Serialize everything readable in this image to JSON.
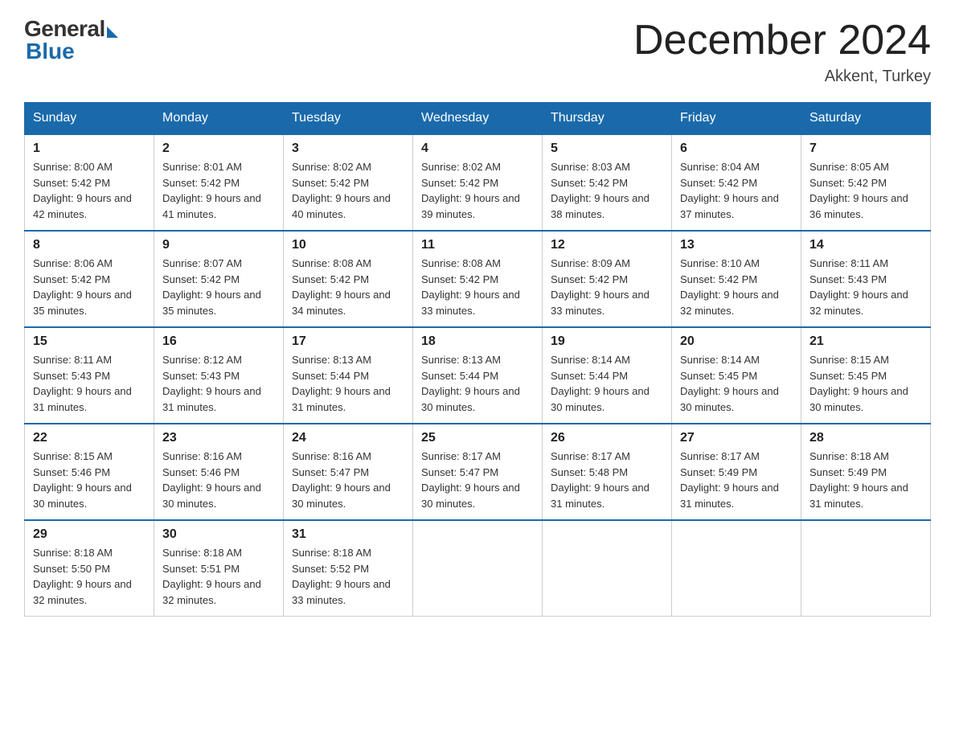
{
  "logo": {
    "general": "General",
    "blue": "Blue"
  },
  "title": "December 2024",
  "location": "Akkent, Turkey",
  "days_of_week": [
    "Sunday",
    "Monday",
    "Tuesday",
    "Wednesday",
    "Thursday",
    "Friday",
    "Saturday"
  ],
  "weeks": [
    [
      {
        "day": "1",
        "sunrise": "8:00 AM",
        "sunset": "5:42 PM",
        "daylight": "9 hours and 42 minutes."
      },
      {
        "day": "2",
        "sunrise": "8:01 AM",
        "sunset": "5:42 PM",
        "daylight": "9 hours and 41 minutes."
      },
      {
        "day": "3",
        "sunrise": "8:02 AM",
        "sunset": "5:42 PM",
        "daylight": "9 hours and 40 minutes."
      },
      {
        "day": "4",
        "sunrise": "8:02 AM",
        "sunset": "5:42 PM",
        "daylight": "9 hours and 39 minutes."
      },
      {
        "day": "5",
        "sunrise": "8:03 AM",
        "sunset": "5:42 PM",
        "daylight": "9 hours and 38 minutes."
      },
      {
        "day": "6",
        "sunrise": "8:04 AM",
        "sunset": "5:42 PM",
        "daylight": "9 hours and 37 minutes."
      },
      {
        "day": "7",
        "sunrise": "8:05 AM",
        "sunset": "5:42 PM",
        "daylight": "9 hours and 36 minutes."
      }
    ],
    [
      {
        "day": "8",
        "sunrise": "8:06 AM",
        "sunset": "5:42 PM",
        "daylight": "9 hours and 35 minutes."
      },
      {
        "day": "9",
        "sunrise": "8:07 AM",
        "sunset": "5:42 PM",
        "daylight": "9 hours and 35 minutes."
      },
      {
        "day": "10",
        "sunrise": "8:08 AM",
        "sunset": "5:42 PM",
        "daylight": "9 hours and 34 minutes."
      },
      {
        "day": "11",
        "sunrise": "8:08 AM",
        "sunset": "5:42 PM",
        "daylight": "9 hours and 33 minutes."
      },
      {
        "day": "12",
        "sunrise": "8:09 AM",
        "sunset": "5:42 PM",
        "daylight": "9 hours and 33 minutes."
      },
      {
        "day": "13",
        "sunrise": "8:10 AM",
        "sunset": "5:42 PM",
        "daylight": "9 hours and 32 minutes."
      },
      {
        "day": "14",
        "sunrise": "8:11 AM",
        "sunset": "5:43 PM",
        "daylight": "9 hours and 32 minutes."
      }
    ],
    [
      {
        "day": "15",
        "sunrise": "8:11 AM",
        "sunset": "5:43 PM",
        "daylight": "9 hours and 31 minutes."
      },
      {
        "day": "16",
        "sunrise": "8:12 AM",
        "sunset": "5:43 PM",
        "daylight": "9 hours and 31 minutes."
      },
      {
        "day": "17",
        "sunrise": "8:13 AM",
        "sunset": "5:44 PM",
        "daylight": "9 hours and 31 minutes."
      },
      {
        "day": "18",
        "sunrise": "8:13 AM",
        "sunset": "5:44 PM",
        "daylight": "9 hours and 30 minutes."
      },
      {
        "day": "19",
        "sunrise": "8:14 AM",
        "sunset": "5:44 PM",
        "daylight": "9 hours and 30 minutes."
      },
      {
        "day": "20",
        "sunrise": "8:14 AM",
        "sunset": "5:45 PM",
        "daylight": "9 hours and 30 minutes."
      },
      {
        "day": "21",
        "sunrise": "8:15 AM",
        "sunset": "5:45 PM",
        "daylight": "9 hours and 30 minutes."
      }
    ],
    [
      {
        "day": "22",
        "sunrise": "8:15 AM",
        "sunset": "5:46 PM",
        "daylight": "9 hours and 30 minutes."
      },
      {
        "day": "23",
        "sunrise": "8:16 AM",
        "sunset": "5:46 PM",
        "daylight": "9 hours and 30 minutes."
      },
      {
        "day": "24",
        "sunrise": "8:16 AM",
        "sunset": "5:47 PM",
        "daylight": "9 hours and 30 minutes."
      },
      {
        "day": "25",
        "sunrise": "8:17 AM",
        "sunset": "5:47 PM",
        "daylight": "9 hours and 30 minutes."
      },
      {
        "day": "26",
        "sunrise": "8:17 AM",
        "sunset": "5:48 PM",
        "daylight": "9 hours and 31 minutes."
      },
      {
        "day": "27",
        "sunrise": "8:17 AM",
        "sunset": "5:49 PM",
        "daylight": "9 hours and 31 minutes."
      },
      {
        "day": "28",
        "sunrise": "8:18 AM",
        "sunset": "5:49 PM",
        "daylight": "9 hours and 31 minutes."
      }
    ],
    [
      {
        "day": "29",
        "sunrise": "8:18 AM",
        "sunset": "5:50 PM",
        "daylight": "9 hours and 32 minutes."
      },
      {
        "day": "30",
        "sunrise": "8:18 AM",
        "sunset": "5:51 PM",
        "daylight": "9 hours and 32 minutes."
      },
      {
        "day": "31",
        "sunrise": "8:18 AM",
        "sunset": "5:52 PM",
        "daylight": "9 hours and 33 minutes."
      },
      null,
      null,
      null,
      null
    ]
  ]
}
